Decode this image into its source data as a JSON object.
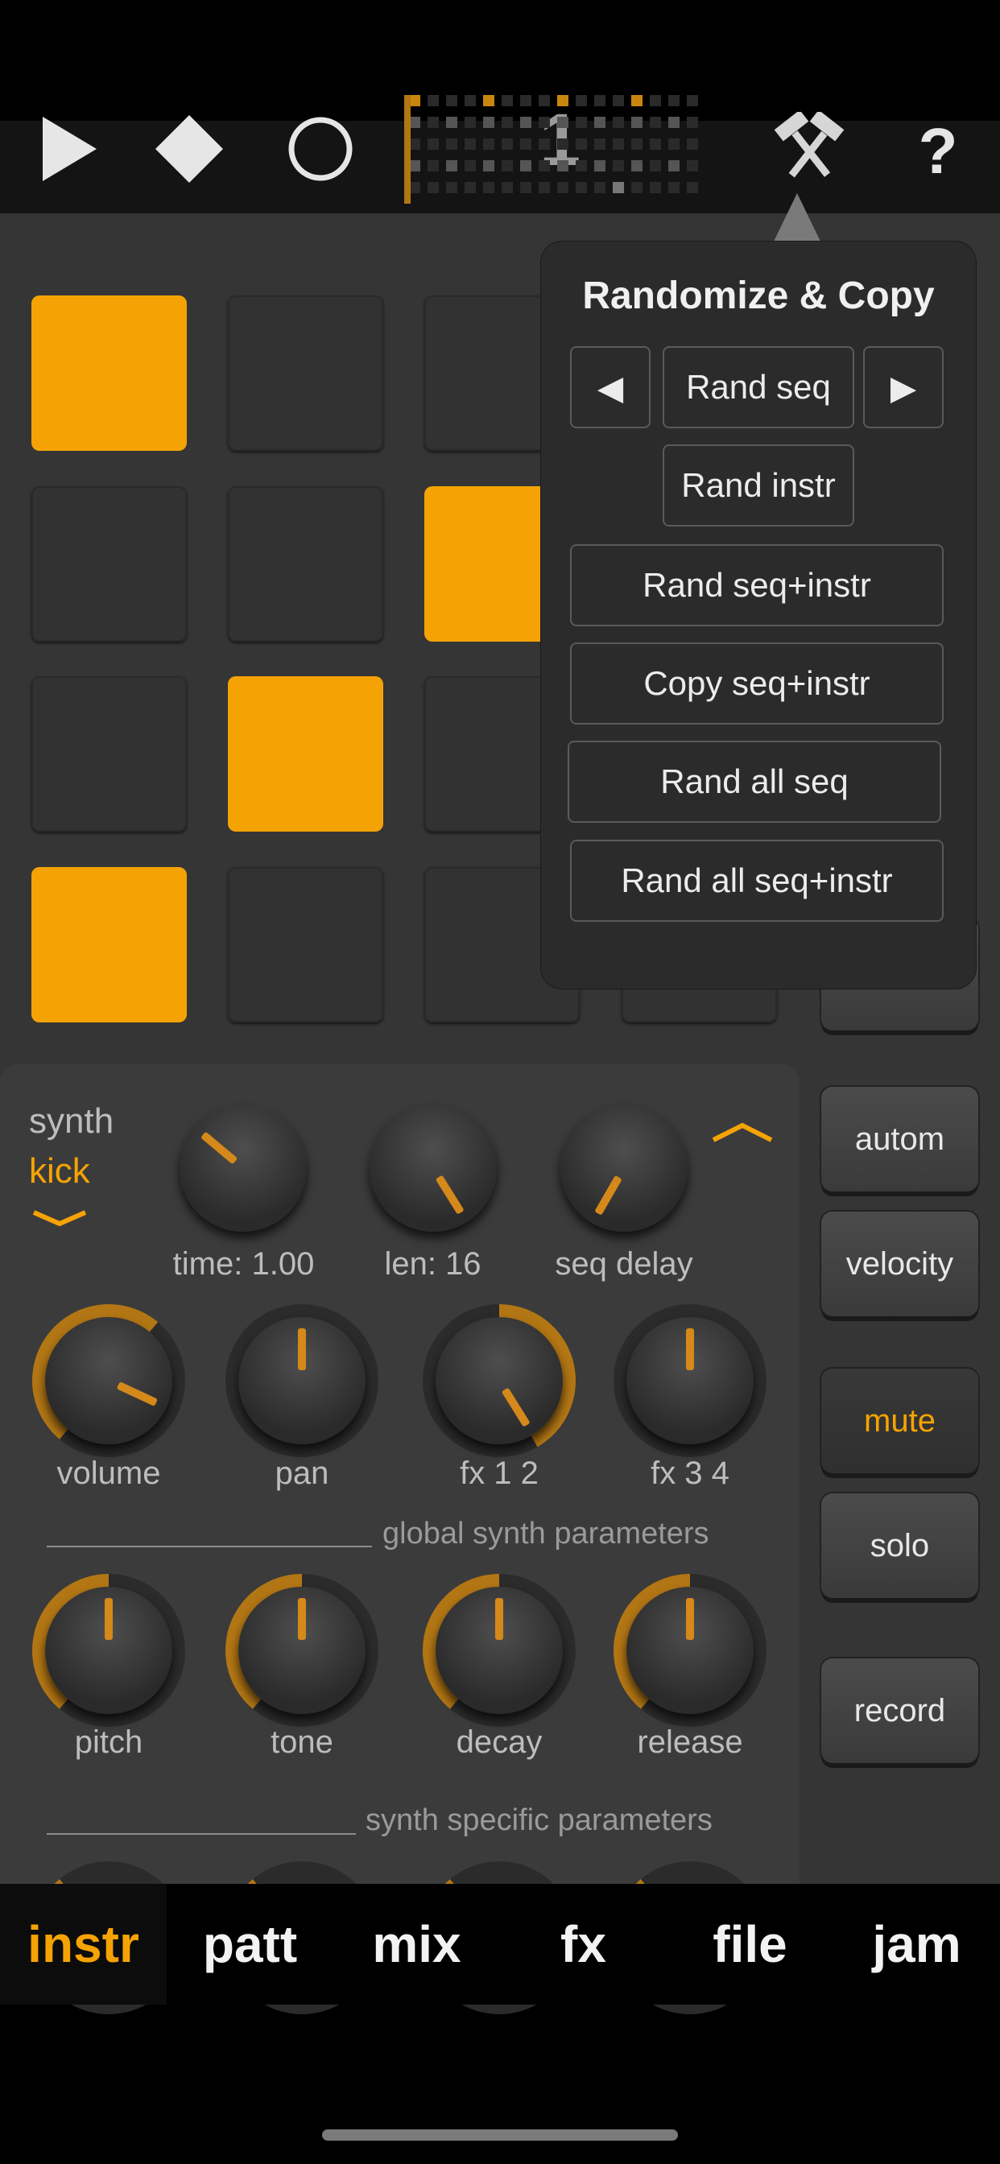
{
  "transport": {
    "play_icon": "play-icon",
    "stop_icon": "stop-diamond-icon",
    "record_icon": "record-circle-icon",
    "pattern_number": "1",
    "tools_icon": "hammer-tools-icon",
    "help_label": "?"
  },
  "popover": {
    "title": "Randomize & Copy",
    "prev_label": "◀",
    "next_label": "▶",
    "rand_seq": "Rand seq",
    "rand_instr": "Rand instr",
    "rand_seq_instr": "Rand seq+instr",
    "copy_seq_instr": "Copy seq+instr",
    "rand_all_seq": "Rand all seq",
    "rand_all_seq_instr": "Rand all seq+instr"
  },
  "instrument": {
    "type": "synth",
    "name": "kick",
    "time_label": "time: 1.00",
    "len_label": "len: 16",
    "seq_delay_label": "seq delay"
  },
  "knobs": {
    "volume": "volume",
    "pan": "pan",
    "fx12": "fx 1 2",
    "fx34": "fx 3 4",
    "pitch": "pitch",
    "tone": "tone",
    "decay": "decay",
    "release": "release"
  },
  "sections": {
    "global": "global synth parameters",
    "specific": "synth specific parameters"
  },
  "side_buttons": {
    "autom": "autom",
    "velocity": "velocity",
    "mute": "mute",
    "solo": "solo",
    "record": "record"
  },
  "tabs": [
    {
      "label": "instr"
    },
    {
      "label": "patt"
    },
    {
      "label": "mix"
    },
    {
      "label": "fx"
    },
    {
      "label": "file"
    },
    {
      "label": "jam"
    }
  ],
  "colors": {
    "accent": "#f5a304",
    "panel": "#353535",
    "background": "#000000"
  }
}
